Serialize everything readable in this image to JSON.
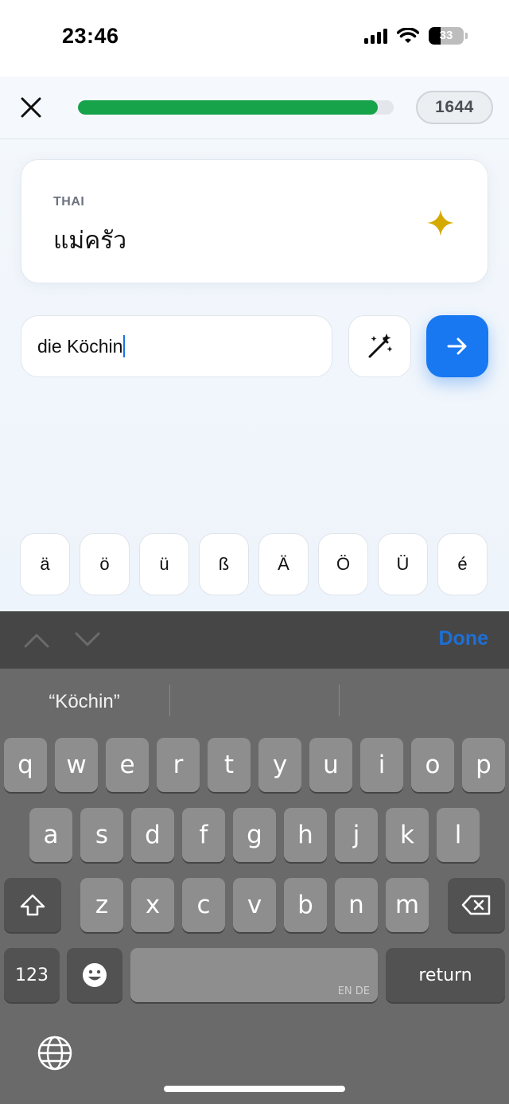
{
  "status_bar": {
    "time": "23:46",
    "battery_percent": "33",
    "battery_level": 0.33
  },
  "topbar": {
    "progress": 0.95,
    "score": "1644"
  },
  "card": {
    "language": "THAI",
    "word": "แม่ครัว"
  },
  "answer": {
    "value": "die Köchin"
  },
  "special_chars": [
    "ä",
    "ö",
    "ü",
    "ß",
    "Ä",
    "Ö",
    "Ü",
    "é"
  ],
  "accessory": {
    "done_label": "Done"
  },
  "keyboard": {
    "suggestions": [
      "“Köchin”",
      "",
      ""
    ],
    "row1": [
      "q",
      "w",
      "e",
      "r",
      "t",
      "y",
      "u",
      "i",
      "o",
      "p"
    ],
    "row2": [
      "a",
      "s",
      "d",
      "f",
      "g",
      "h",
      "j",
      "k",
      "l"
    ],
    "row3": [
      "z",
      "x",
      "c",
      "v",
      "b",
      "n",
      "m"
    ],
    "numbers_label": "123",
    "space_lang": "EN DE",
    "return_label": "return"
  },
  "colors": {
    "accent": "#1778f2",
    "progress": "#16a34a",
    "sparkle": "#d4a900",
    "done": "#1e6fd6"
  },
  "icons": {
    "close": "close-icon",
    "sparkle": "sparkle-icon",
    "magic": "magic-wand-icon",
    "submit": "arrow-right-icon",
    "shift": "shift-icon",
    "delete": "backspace-icon",
    "emoji": "emoji-icon",
    "globe": "globe-icon"
  }
}
